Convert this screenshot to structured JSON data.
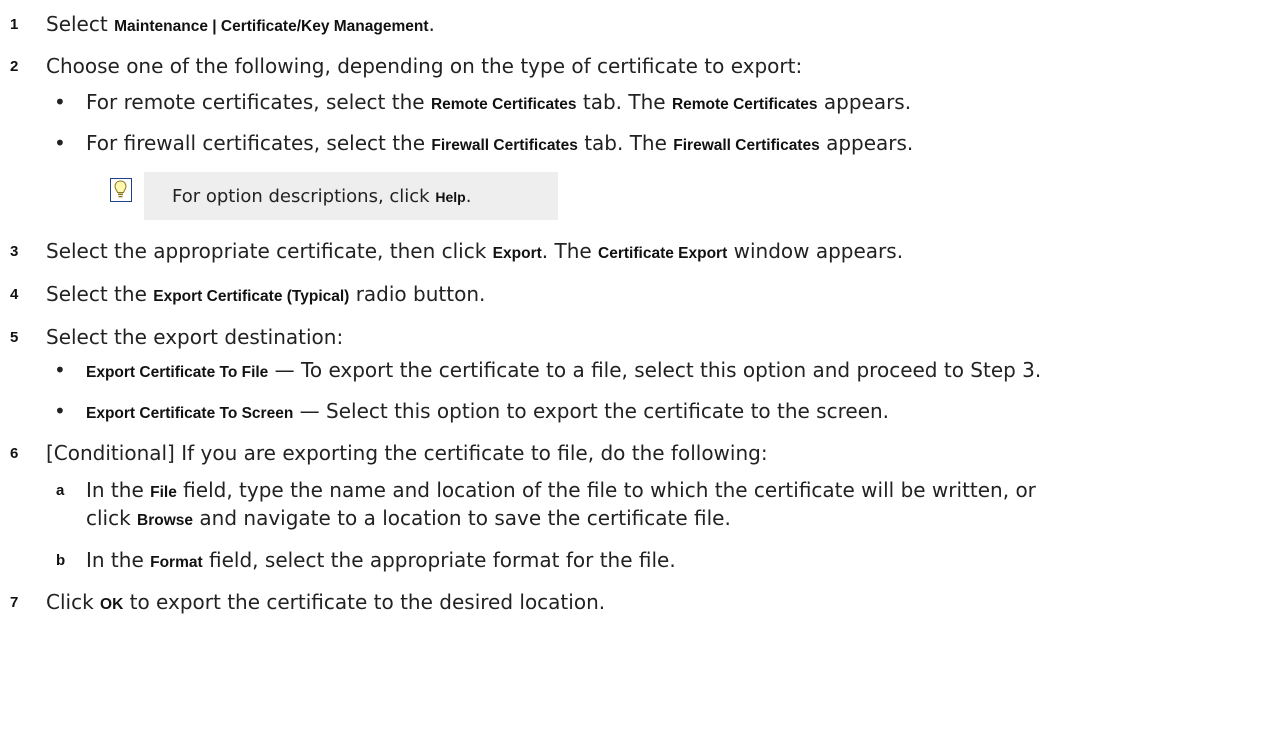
{
  "steps": [
    {
      "number": "1",
      "parts": [
        "Select ",
        "Maintenance | Certificate/Key Management",
        "."
      ]
    },
    {
      "number": "2",
      "text": "Choose one of the following, depending on the type of certificate to export:",
      "bullets": [
        {
          "pre": "For remote certificates, select the ",
          "ui1": "Remote Certificates",
          "mid": " tab. The ",
          "ui2": "Remote Certificates",
          "post": " appears."
        },
        {
          "pre": "For firewall certificates, select the ",
          "ui1": "Firewall Certificates",
          "mid": " tab. The ",
          "ui2": "Firewall Certificates",
          "post": " appears."
        }
      ]
    },
    {
      "number": "3",
      "pre": "Select the appropriate certificate, then click ",
      "ui1": "Export",
      "mid": ". The ",
      "ui2": "Certificate Export",
      "post": " window appears."
    },
    {
      "number": "4",
      "pre": "Select the ",
      "ui1": "Export Certificate (Typical)",
      "post": " radio button."
    },
    {
      "number": "5",
      "text": "Select the export destination:",
      "bullets": [
        {
          "ui": "Export Certificate To File",
          "text": " — To export the certificate to a file, select this option and proceed to Step 3."
        },
        {
          "ui": "Export Certificate To Screen",
          "text": " — Select this option to export the certificate to the screen."
        }
      ]
    },
    {
      "number": "6",
      "text": "[Conditional] If you are exporting the certificate to file, do the following:",
      "substeps": [
        {
          "letter": "a",
          "pre": "In the ",
          "ui1": "File",
          "mid": " field, type the name and location of the file to which the certificate will be written, or",
          "line2_pre": "click ",
          "ui2": "Browse",
          "line2_post": " and navigate to a location to save the certificate file."
        },
        {
          "letter": "b",
          "pre": "In the ",
          "ui1": "Format",
          "post": " field, select the appropriate format for the file."
        }
      ]
    },
    {
      "number": "7",
      "pre": "Click ",
      "ui1": "OK",
      "post": " to export the certificate to the desired location."
    }
  ],
  "tip": {
    "pre": "For option descriptions, click ",
    "ui": "Help",
    "post": ".",
    "icon": "lightbulb-icon"
  }
}
